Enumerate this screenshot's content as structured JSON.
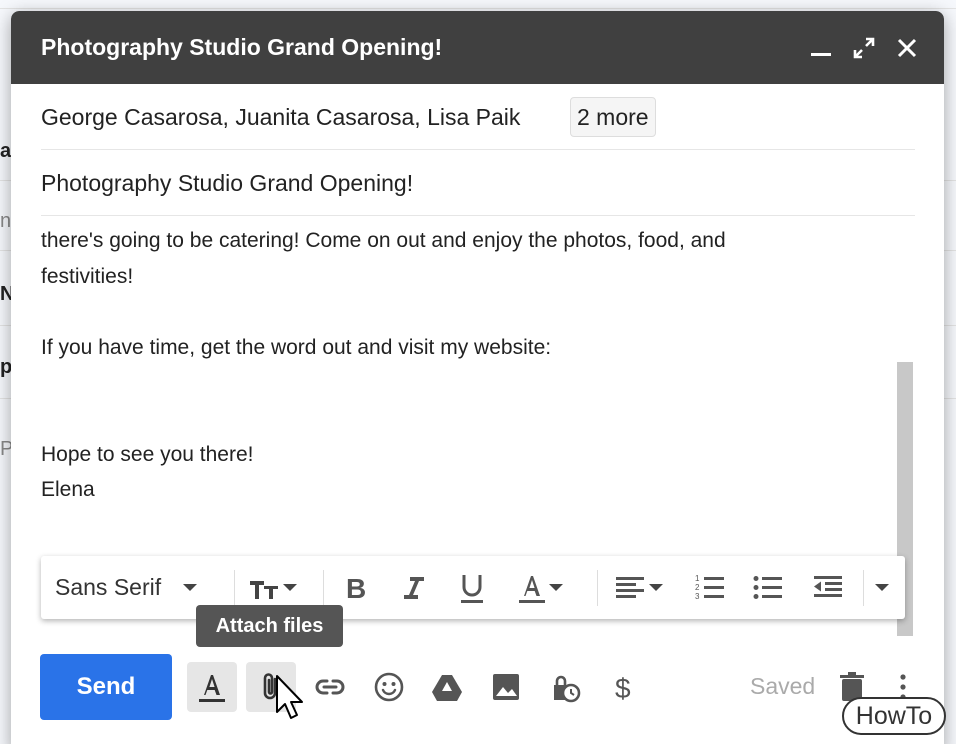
{
  "background": {
    "letters": [
      "a",
      "n",
      "N",
      "p",
      "P"
    ]
  },
  "compose": {
    "title": "Photography Studio Grand Opening!",
    "recipients": "George Casarosa, Juanita Casarosa, Lisa Paik",
    "more_recipients": "2 more",
    "subject": "Photography Studio Grand Opening!",
    "body_lines": [
      "there's going to be catering! Come on out and enjoy the photos, food, and",
      "festivities!",
      "If you have time, get the word out and visit my website:",
      "Hope to see you there!",
      "Elena"
    ]
  },
  "formatting": {
    "font": "Sans Serif"
  },
  "tooltip": "Attach files",
  "actions": {
    "send_label": "Send",
    "saved_label": "Saved"
  },
  "watermark": "HowTo",
  "colors": {
    "titlebar": "#404040",
    "send": "#2a73e8"
  }
}
